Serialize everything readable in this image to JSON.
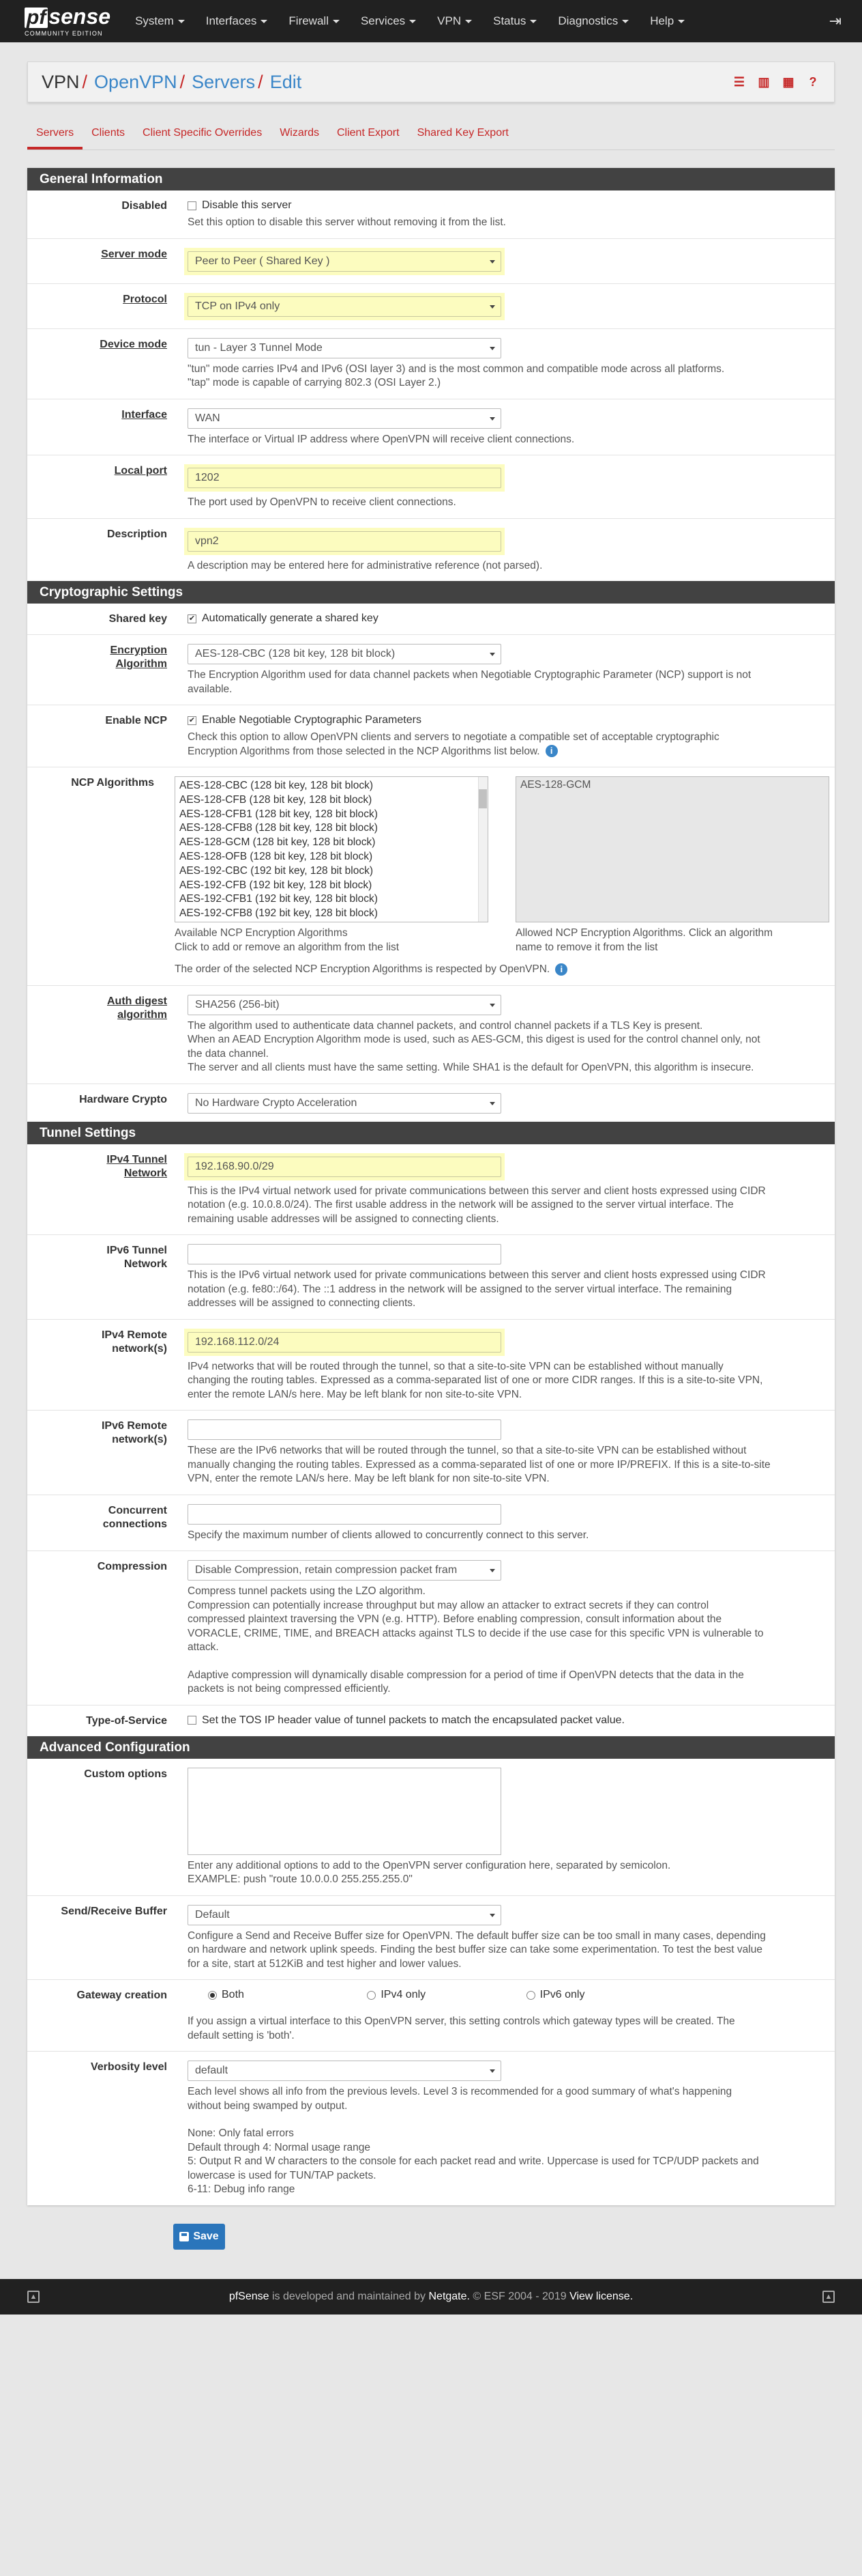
{
  "brand": {
    "logo_pf": "pf",
    "logo_sense": "sense",
    "logo_sub": "COMMUNITY EDITION"
  },
  "nav": [
    "System",
    "Interfaces",
    "Firewall",
    "Services",
    "VPN",
    "Status",
    "Diagnostics",
    "Help"
  ],
  "breadcrumb": [
    "VPN",
    "OpenVPN",
    "Servers",
    "Edit"
  ],
  "tabs": [
    "Servers",
    "Clients",
    "Client Specific Overrides",
    "Wizards",
    "Client Export",
    "Shared Key Export"
  ],
  "general": {
    "heading": "General Information",
    "disabled": {
      "label": "Disabled",
      "check": "Disable this server",
      "help": "Set this option to disable this server without removing it from the list."
    },
    "server_mode": {
      "label": "Server mode",
      "value": "Peer to Peer ( Shared Key )"
    },
    "protocol": {
      "label": "Protocol",
      "value": "TCP on IPv4 only"
    },
    "device_mode": {
      "label": "Device mode",
      "value": "tun - Layer 3 Tunnel Mode",
      "help1": "\"tun\" mode carries IPv4 and IPv6 (OSI layer 3) and is the most common and compatible mode across all platforms.",
      "help2": "\"tap\" mode is capable of carrying 802.3 (OSI Layer 2.)"
    },
    "interface": {
      "label": "Interface",
      "value": "WAN",
      "help": "The interface or Virtual IP address where OpenVPN will receive client connections."
    },
    "local_port": {
      "label": "Local port",
      "value": "1202",
      "help": "The port used by OpenVPN to receive client connections."
    },
    "description": {
      "label": "Description",
      "value": "vpn2",
      "help": "A description may be entered here for administrative reference (not parsed)."
    }
  },
  "crypto": {
    "heading": "Cryptographic Settings",
    "shared_key": {
      "label": "Shared key",
      "check": "Automatically generate a shared key"
    },
    "encryption": {
      "label1": "Encryption",
      "label2": "Algorithm",
      "value": "AES-128-CBC (128 bit key, 128 bit block)",
      "help1": "The Encryption Algorithm used for data channel packets when Negotiable Cryptographic Parameter (NCP) support is not",
      "help2": "available."
    },
    "ncp": {
      "label": "Enable NCP",
      "check": "Enable Negotiable Cryptographic Parameters",
      "help1": "Check this option to allow OpenVPN clients and servers to negotiate a compatible set of acceptable cryptographic",
      "help2": "Encryption Algorithms from those selected in the NCP Algorithms list below."
    },
    "ncp_algos": {
      "label": "NCP Algorithms",
      "available": [
        "AES-128-CBC (128 bit key, 128 bit block)",
        "AES-128-CFB (128 bit key, 128 bit block)",
        "AES-128-CFB1 (128 bit key, 128 bit block)",
        "AES-128-CFB8 (128 bit key, 128 bit block)",
        "AES-128-GCM (128 bit key, 128 bit block)",
        "AES-128-OFB (128 bit key, 128 bit block)",
        "AES-192-CBC (192 bit key, 128 bit block)",
        "AES-192-CFB (192 bit key, 128 bit block)",
        "AES-192-CFB1 (192 bit key, 128 bit block)",
        "AES-192-CFB8 (192 bit key, 128 bit block)"
      ],
      "allowed": [
        "AES-128-GCM"
      ],
      "help_left1": "Available NCP Encryption Algorithms",
      "help_left2": "Click to add or remove an algorithm from the list",
      "help_right1": "Allowed NCP Encryption Algorithms. Click an algorithm",
      "help_right2": "name to remove it from the list",
      "order_note": "The order of the selected NCP Encryption Algorithms is respected by OpenVPN."
    },
    "auth": {
      "label1": "Auth digest",
      "label2": "algorithm",
      "value": "SHA256 (256-bit)",
      "help1": "The algorithm used to authenticate data channel packets, and control channel packets if a TLS Key is present.",
      "help2": "When an AEAD Encryption Algorithm mode is used, such as AES-GCM, this digest is used for the control channel only, not",
      "help3": "the data channel.",
      "help4": "The server and all clients must have the same setting. While SHA1 is the default for OpenVPN, this algorithm is insecure."
    },
    "hw_crypto": {
      "label": "Hardware Crypto",
      "value": "No Hardware Crypto Acceleration"
    }
  },
  "tunnel": {
    "heading": "Tunnel Settings",
    "ipv4_tunnel": {
      "label1": "IPv4 Tunnel",
      "label2": "Network",
      "value": "192.168.90.0/29",
      "help1": "This is the IPv4 virtual network used for private communications between this server and client hosts expressed using CIDR",
      "help2": "notation (e.g. 10.0.8.0/24). The first usable address in the network will be assigned to the server virtual interface. The",
      "help3": "remaining usable addresses will be assigned to connecting clients."
    },
    "ipv6_tunnel": {
      "label1": "IPv6 Tunnel",
      "label2": "Network",
      "help1": "This is the IPv6 virtual network used for private communications between this server and client hosts expressed using CIDR",
      "help2": "notation (e.g. fe80::/64). The ::1 address in the network will be assigned to the server virtual interface. The remaining",
      "help3": "addresses will be assigned to connecting clients."
    },
    "ipv4_remote": {
      "label1": "IPv4 Remote",
      "label2": "network(s)",
      "value": "192.168.112.0/24",
      "help1": "IPv4 networks that will be routed through the tunnel, so that a site-to-site VPN can be established without manually",
      "help2": "changing the routing tables. Expressed as a comma-separated list of one or more CIDR ranges. If this is a site-to-site VPN,",
      "help3": "enter the remote LAN/s here. May be left blank for non site-to-site VPN."
    },
    "ipv6_remote": {
      "label1": "IPv6 Remote",
      "label2": "network(s)",
      "help1": "These are the IPv6 networks that will be routed through the tunnel, so that a site-to-site VPN can be established without",
      "help2": "manually changing the routing tables. Expressed as a comma-separated list of one or more IP/PREFIX. If this is a site-to-site",
      "help3": "VPN, enter the remote LAN/s here. May be left blank for non site-to-site VPN."
    },
    "concurrent": {
      "label1": "Concurrent",
      "label2": "connections",
      "help": "Specify the maximum number of clients allowed to concurrently connect to this server."
    },
    "compression": {
      "label": "Compression",
      "value": "Disable Compression, retain compression packet fram",
      "help1": "Compress tunnel packets using the LZO algorithm.",
      "help2": "Compression can potentially increase throughput but may allow an attacker to extract secrets if they can control",
      "help3": "compressed plaintext traversing the VPN (e.g. HTTP). Before enabling compression, consult information about the",
      "help4": "VORACLE, CRIME, TIME, and BREACH attacks against TLS to decide if the use case for this specific VPN is vulnerable to",
      "help5": "attack.",
      "help6": "Adaptive compression will dynamically disable compression for a period of time if OpenVPN detects that the data in the",
      "help7": "packets is not being compressed efficiently."
    },
    "tos": {
      "label": "Type-of-Service",
      "check": "Set the TOS IP header value of tunnel packets to match the encapsulated packet value."
    }
  },
  "advanced": {
    "heading": "Advanced Configuration",
    "custom": {
      "label": "Custom options",
      "help1": "Enter any additional options to add to the OpenVPN server configuration here, separated by semicolon.",
      "help2": "EXAMPLE: push \"route 10.0.0.0 255.255.255.0\""
    },
    "buffer": {
      "label": "Send/Receive Buffer",
      "value": "Default",
      "help1": "Configure a Send and Receive Buffer size for OpenVPN. The default buffer size can be too small in many cases, depending",
      "help2": "on hardware and network uplink speeds. Finding the best buffer size can take some experimentation. To test the best value",
      "help3": "for a site, start at 512KiB and test higher and lower values."
    },
    "gateway": {
      "label": "Gateway creation",
      "options": [
        "Both",
        "IPv4 only",
        "IPv6 only"
      ],
      "help1": "If you assign a virtual interface to this OpenVPN server, this setting controls which gateway types will be created. The",
      "help2": "default setting is 'both'."
    },
    "verbosity": {
      "label": "Verbosity level",
      "value": "default",
      "help1": "Each level shows all info from the previous levels. Level 3 is recommended for a good summary of what's happening",
      "help2": "without being swamped by output.",
      "help3": "None: Only fatal errors",
      "help4": "Default through 4: Normal usage range",
      "help5": "5: Output R and W characters to the console for each packet read and write. Uppercase is used for TCP/UDP packets and",
      "help6": "lowercase is used for TUN/TAP packets.",
      "help7": "6-11: Debug info range"
    }
  },
  "save_label": "Save",
  "footer": {
    "brand": "pfSense",
    "text1": " is developed and maintained by ",
    "netgate": "Netgate.",
    "text2": " © ESF 2004 - 2019 ",
    "license": "View license."
  }
}
